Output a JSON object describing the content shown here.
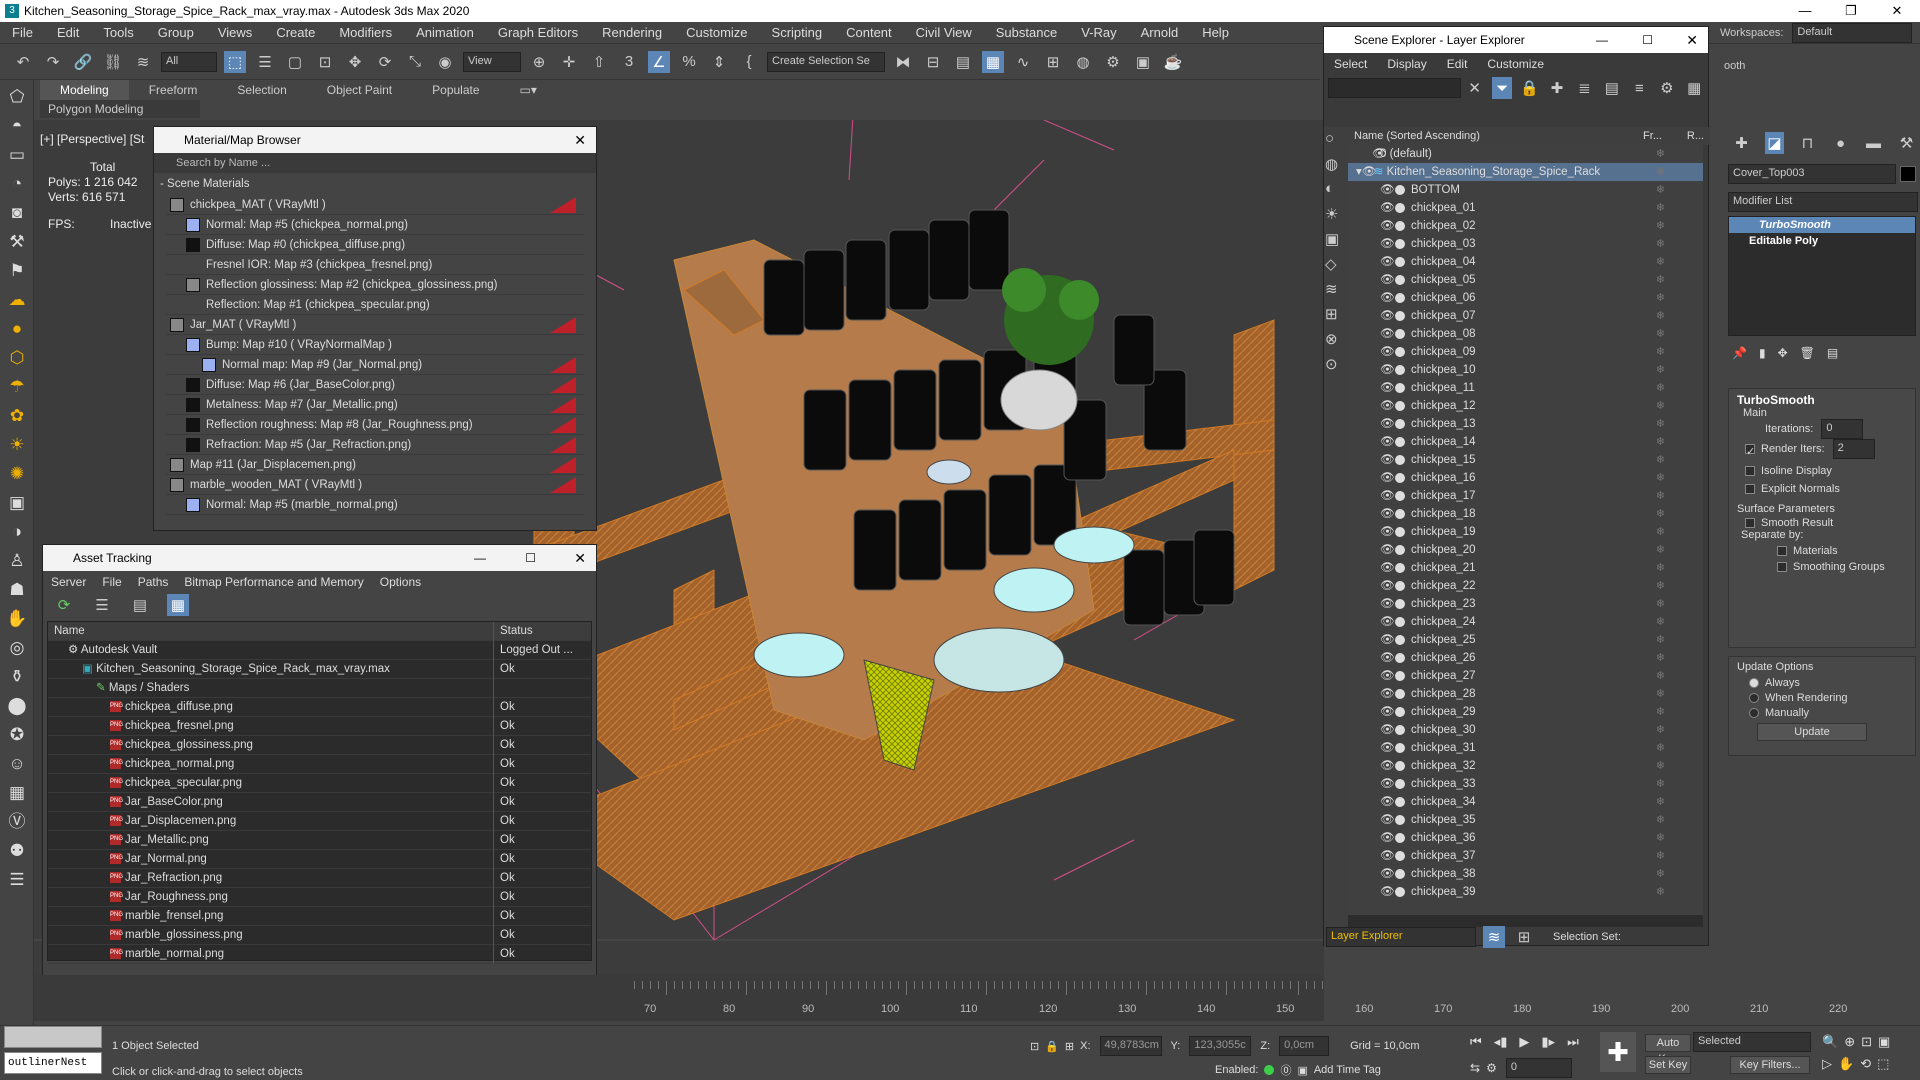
{
  "app": {
    "title": "Kitchen_Seasoning_Storage_Spice_Rack_max_vray.max - Autodesk 3ds Max 2020",
    "window_buttons": [
      "—",
      "❐",
      "✕"
    ]
  },
  "menu": [
    "File",
    "Edit",
    "Tools",
    "Group",
    "Views",
    "Create",
    "Modifiers",
    "Animation",
    "Graph Editors",
    "Rendering",
    "Customize",
    "Scripting",
    "Content",
    "Civil View",
    "Substance",
    "V-Ray",
    "Arnold",
    "Help"
  ],
  "workspaces": {
    "label": "Workspaces:",
    "value": "Default"
  },
  "toolbar": {
    "filter_all": "All",
    "view_dd": "View",
    "create_selection": "Create Selection Se"
  },
  "ribbon": {
    "tabs": [
      "Modeling",
      "Freeform",
      "Selection",
      "Object Paint",
      "Populate"
    ],
    "sub": "Polygon Modeling"
  },
  "viewport": {
    "label": "[+] [Perspective] [St",
    "stats": {
      "total_label": "Total",
      "polys_label": "Polys:",
      "polys": "1 216 042",
      "verts_label": "Verts:",
      "verts": "616 571",
      "fps_label": "FPS:",
      "fps": "Inactive"
    }
  },
  "material_browser": {
    "title": "Material/Map Browser",
    "search_placeholder": "Search by Name ...",
    "section": "- Scene Materials",
    "items": [
      {
        "text": "chickpea_MAT  ( VRayMtl )",
        "level": 0,
        "swatch": "gray",
        "red": true
      },
      {
        "text": "Normal: Map #5 (chickpea_normal.png)",
        "level": 1,
        "swatch": "blue",
        "red": false
      },
      {
        "text": "Diffuse: Map #0 (chickpea_diffuse.png)",
        "level": 1,
        "swatch": "dark",
        "red": false
      },
      {
        "text": "Fresnel IOR: Map #3 (chickpea_fresnel.png)",
        "level": 1,
        "swatch": "none",
        "red": false
      },
      {
        "text": "Reflection glossiness: Map #2 (chickpea_glossiness.png)",
        "level": 1,
        "swatch": "gray",
        "red": false
      },
      {
        "text": "Reflection: Map #1 (chickpea_specular.png)",
        "level": 1,
        "swatch": "none",
        "red": false
      },
      {
        "text": "Jar_MAT  ( VRayMtl )",
        "level": 0,
        "swatch": "gray",
        "red": true
      },
      {
        "text": "Bump: Map #10  ( VRayNormalMap )",
        "level": 1,
        "swatch": "blue",
        "red": false
      },
      {
        "text": "Normal map: Map #9 (Jar_Normal.png)",
        "level": 2,
        "swatch": "blue",
        "red": true
      },
      {
        "text": "Diffuse: Map #6 (Jar_BaseColor.png)",
        "level": 1,
        "swatch": "dark",
        "red": true
      },
      {
        "text": "Metalness: Map #7 (Jar_Metallic.png)",
        "level": 1,
        "swatch": "dark",
        "red": true
      },
      {
        "text": "Reflection roughness: Map #8 (Jar_Roughness.png)",
        "level": 1,
        "swatch": "dark",
        "red": true
      },
      {
        "text": "Refraction: Map #5 (Jar_Refraction.png)",
        "level": 1,
        "swatch": "dark",
        "red": true
      },
      {
        "text": "Map #11 (Jar_Displacemen.png)",
        "level": 0,
        "swatch": "gray",
        "red": true
      },
      {
        "text": "marble_wooden_MAT  ( VRayMtl )",
        "level": 0,
        "swatch": "gray",
        "red": true
      },
      {
        "text": "Normal: Map #5 (marble_normal.png)",
        "level": 1,
        "swatch": "blue",
        "red": false
      }
    ]
  },
  "asset_tracking": {
    "title": "Asset Tracking",
    "menu": [
      "Server",
      "File",
      "Paths",
      "Bitmap Performance and Memory",
      "Options"
    ],
    "col_name": "Name",
    "col_status": "Status",
    "rows": [
      {
        "name": "Autodesk Vault",
        "status": "Logged Out ...",
        "indent": 0,
        "type": "vault"
      },
      {
        "name": "Kitchen_Seasoning_Storage_Spice_Rack_max_vray.max",
        "status": "Ok",
        "indent": 1,
        "type": "max"
      },
      {
        "name": "Maps / Shaders",
        "status": "",
        "indent": 2,
        "type": "folder"
      },
      {
        "name": "chickpea_diffuse.png",
        "status": "Ok",
        "indent": 3,
        "type": "png"
      },
      {
        "name": "chickpea_fresnel.png",
        "status": "Ok",
        "indent": 3,
        "type": "png"
      },
      {
        "name": "chickpea_glossiness.png",
        "status": "Ok",
        "indent": 3,
        "type": "png"
      },
      {
        "name": "chickpea_normal.png",
        "status": "Ok",
        "indent": 3,
        "type": "png"
      },
      {
        "name": "chickpea_specular.png",
        "status": "Ok",
        "indent": 3,
        "type": "png"
      },
      {
        "name": "Jar_BaseColor.png",
        "status": "Ok",
        "indent": 3,
        "type": "png"
      },
      {
        "name": "Jar_Displacemen.png",
        "status": "Ok",
        "indent": 3,
        "type": "png"
      },
      {
        "name": "Jar_Metallic.png",
        "status": "Ok",
        "indent": 3,
        "type": "png"
      },
      {
        "name": "Jar_Normal.png",
        "status": "Ok",
        "indent": 3,
        "type": "png"
      },
      {
        "name": "Jar_Refraction.png",
        "status": "Ok",
        "indent": 3,
        "type": "png"
      },
      {
        "name": "Jar_Roughness.png",
        "status": "Ok",
        "indent": 3,
        "type": "png"
      },
      {
        "name": "marble_frensel.png",
        "status": "Ok",
        "indent": 3,
        "type": "png"
      },
      {
        "name": "marble_glossiness.png",
        "status": "Ok",
        "indent": 3,
        "type": "png"
      },
      {
        "name": "marble_normal.png",
        "status": "Ok",
        "indent": 3,
        "type": "png"
      }
    ]
  },
  "scene_explorer": {
    "title": "Scene Explorer - Layer Explorer",
    "menu": [
      "Select",
      "Display",
      "Edit",
      "Customize"
    ],
    "col_name": "Name (Sorted Ascending)",
    "col_fr": "Fr...",
    "col_r": "R...",
    "layer_default": "0 (default)",
    "layer_main": "Kitchen_Seasoning_Storage_Spice_Rack",
    "objects": [
      "BOTTOM",
      "chickpea_01",
      "chickpea_02",
      "chickpea_03",
      "chickpea_04",
      "chickpea_05",
      "chickpea_06",
      "chickpea_07",
      "chickpea_08",
      "chickpea_09",
      "chickpea_10",
      "chickpea_11",
      "chickpea_12",
      "chickpea_13",
      "chickpea_14",
      "chickpea_15",
      "chickpea_16",
      "chickpea_17",
      "chickpea_18",
      "chickpea_19",
      "chickpea_20",
      "chickpea_21",
      "chickpea_22",
      "chickpea_23",
      "chickpea_24",
      "chickpea_25",
      "chickpea_26",
      "chickpea_27",
      "chickpea_28",
      "chickpea_29",
      "chickpea_30",
      "chickpea_31",
      "chickpea_32",
      "chickpea_33",
      "chickpea_34",
      "chickpea_35",
      "chickpea_36",
      "chickpea_37",
      "chickpea_38",
      "chickpea_39"
    ],
    "bottom_dd": "Layer Explorer",
    "selection_set": "Selection Set:"
  },
  "command_panel": {
    "object_name": "Cover_Top003",
    "modifier_list": "Modifier List",
    "stack": [
      "TurboSmooth",
      "Editable Poly"
    ],
    "rollout": "TurboSmooth",
    "main": "Main",
    "iterations_label": "Iterations:",
    "iterations": "0",
    "render_iters_label": "Render Iters:",
    "render_iters": "2",
    "isoline": "Isoline Display",
    "explicit": "Explicit Normals",
    "surface": "Surface Parameters",
    "smooth_result": "Smooth Result",
    "separate": "Separate by:",
    "materials": "Materials",
    "smoothing": "Smoothing Groups",
    "update_opts": "Update Options",
    "always": "Always",
    "when_rendering": "When Rendering",
    "manually": "Manually",
    "update_btn": "Update",
    "partial_label": "ooth"
  },
  "timeline": {
    "ticks": [
      "70",
      "80",
      "90",
      "100",
      "110",
      "120",
      "130",
      "140",
      "150",
      "160",
      "170",
      "180",
      "190",
      "200",
      "210",
      "220"
    ]
  },
  "status": {
    "script": "outlinerNest",
    "selected": "1 Object Selected",
    "hint": "Click or click-and-drag to select objects",
    "x_label": "X:",
    "x": "49,8783cm",
    "y_label": "Y:",
    "y": "123,3055c",
    "z_label": "Z:",
    "z": "0,0cm",
    "grid": "Grid = 10,0cm",
    "enabled": "Enabled:",
    "add_time_tag": "Add Time Tag",
    "auto_key": "Auto Key",
    "set_key": "Set Key",
    "selected_dd": "Selected",
    "key_filters": "Key Filters...",
    "frame": "0"
  }
}
